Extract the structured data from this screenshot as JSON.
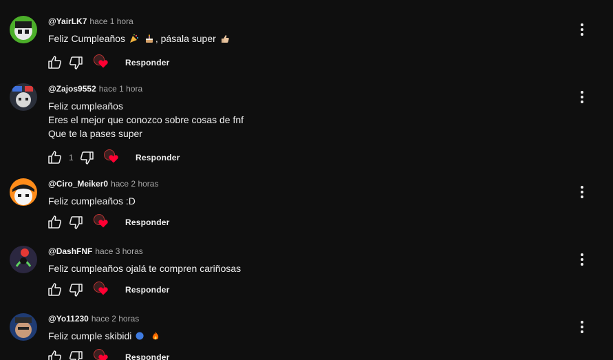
{
  "comments": [
    {
      "author": "@YairLK7",
      "time": "hace 1 hora",
      "lines": [
        "Feliz Cumpleaños",
        ", pásala super"
      ],
      "emojis": [
        "party-popper-emoji",
        "cake-emoji",
        "thumbs-up-emoji"
      ],
      "likes": "",
      "reply_label": "Responder"
    },
    {
      "author": "@Zajos9552",
      "time": "hace 1 hora",
      "lines": [
        "Feliz cumpleaños",
        "Eres el mejor que conozco sobre cosas de fnf",
        "Que te la pases super"
      ],
      "likes": "1",
      "reply_label": "Responder"
    },
    {
      "author": "@Ciro_Meiker0",
      "time": "hace 2 horas",
      "lines": [
        "Feliz cumpleaños :D"
      ],
      "likes": "",
      "reply_label": "Responder"
    },
    {
      "author": "@DashFNF",
      "time": "hace 3 horas",
      "lines": [
        "Feliz cumpleaños ojalá te compren cariñosas"
      ],
      "likes": "",
      "reply_label": "Responder"
    },
    {
      "author": "@Yo11230",
      "time": "hace 2 horas",
      "lines": [
        "Feliz cumple skibidi"
      ],
      "emojis": [
        "speaking-head-emoji",
        "fire-emoji"
      ],
      "likes": "",
      "reply_label": "Responder"
    }
  ],
  "icons": {
    "like": "thumbs-up-outline-icon",
    "dislike": "thumbs-down-outline-icon",
    "creator_heart": "creator-heart-icon",
    "more": "more-vertical-icon"
  },
  "colors": {
    "background": "#0f0f0f",
    "text_primary": "#f1f1f1",
    "text_secondary": "#aaaaaa",
    "heart": "#ff0033"
  }
}
